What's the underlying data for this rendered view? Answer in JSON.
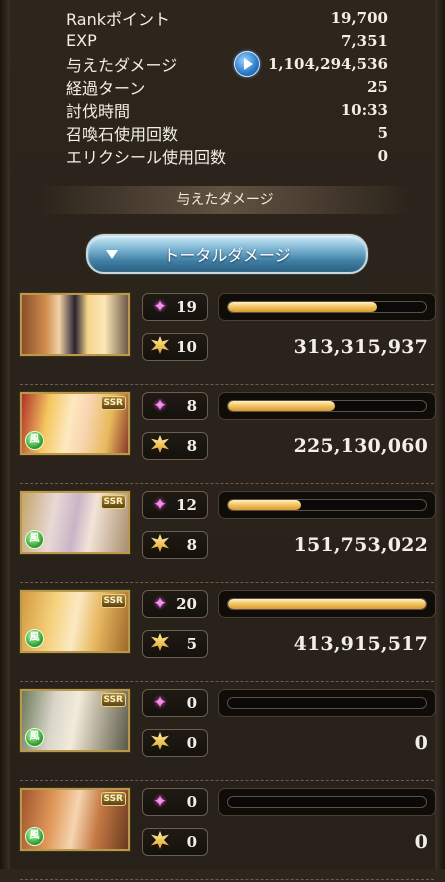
{
  "stats": [
    {
      "label": "Rankポイント",
      "value": "19,700"
    },
    {
      "label": "EXP",
      "value": "7,351"
    },
    {
      "label": "与えたダメージ",
      "value": "1,104,294,536",
      "icon": "play-icon"
    },
    {
      "label": "経過ターン",
      "value": "25"
    },
    {
      "label": "討伐時間",
      "value": "10:33"
    },
    {
      "label": "召喚石使用回数",
      "value": "5"
    },
    {
      "label": "エリクシール使用回数",
      "value": "0"
    }
  ],
  "section_heading": "与えたダメージ",
  "dropdown": {
    "label": "トータルダメージ"
  },
  "characters": [
    {
      "rarity": "",
      "element": "",
      "skills": "19",
      "ougi": "10",
      "damage": "313,315,937",
      "bar": 0.75,
      "art": "linear-gradient(90deg,#8a4f2c 0%,#d08a4a 22%,#f1d2a8 35%,#2a2230 50%,#f4d58a 62%,#fbe6b8 78%,#6e5a48 100%)"
    },
    {
      "rarity": "SSR",
      "element": "風",
      "skills": "8",
      "ougi": "8",
      "damage": "225,130,060",
      "bar": 0.54,
      "art": "linear-gradient(100deg,#b0302a 0%,#f5c760 25%,#fde9c0 45%,#f8d4b0 60%,#e9b95c 80%,#8a3a2a 100%)"
    },
    {
      "rarity": "SSR",
      "element": "風",
      "skills": "12",
      "ougi": "8",
      "damage": "151,753,022",
      "bar": 0.37,
      "art": "linear-gradient(100deg,#c4a46a 0%,#e8d9d6 30%,#c9b4c6 50%,#f3e4d8 65%,#a88f6e 100%)"
    },
    {
      "rarity": "SSR",
      "element": "風",
      "skills": "20",
      "ougi": "5",
      "damage": "413,915,517",
      "bar": 1.0,
      "art": "linear-gradient(100deg,#d39a40 0%,#f6d27e 30%,#fbe9c4 50%,#e8b862 70%,#9e6a2a 100%)"
    },
    {
      "rarity": "SSR",
      "element": "風",
      "skills": "0",
      "ougi": "0",
      "damage": "0",
      "bar": 0.0,
      "art": "linear-gradient(100deg,#6c7a5a 0%,#d9d6c9 30%,#f2ebdc 50%,#b7b09c 70%,#5a5a48 100%)"
    },
    {
      "rarity": "SSR",
      "element": "風",
      "skills": "0",
      "ougi": "0",
      "damage": "0",
      "bar": 0.0,
      "art": "linear-gradient(100deg,#a0542c 0%,#e29a5c 30%,#f5d5b0 50%,#c77a44 70%,#6a3a20 100%)"
    }
  ]
}
